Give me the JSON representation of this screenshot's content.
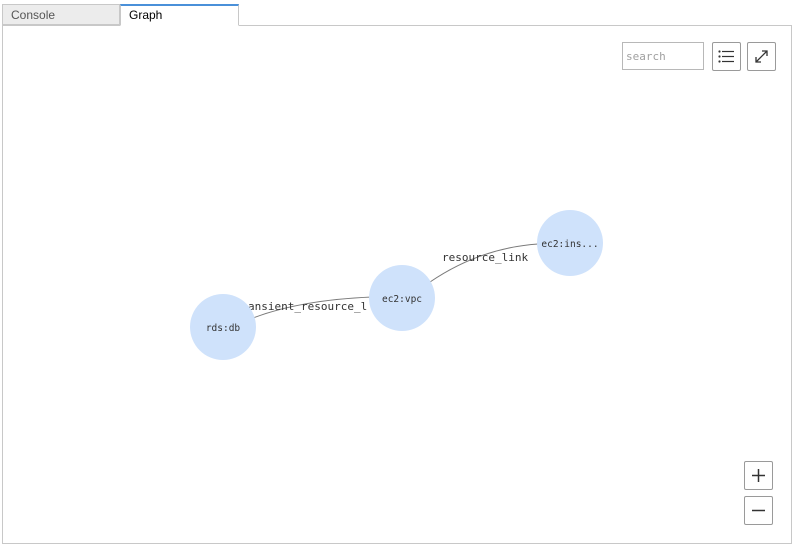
{
  "tabs": [
    {
      "label": "Console",
      "active": false
    },
    {
      "label": "Graph",
      "active": true
    }
  ],
  "toolbar": {
    "search_placeholder": "search",
    "list_icon": "list-icon",
    "expand_icon": "expand-icon"
  },
  "zoom": {
    "in_icon": "plus-icon",
    "out_icon": "minus-icon"
  },
  "graph": {
    "nodes": [
      {
        "id": "rds",
        "label": "rds:db"
      },
      {
        "id": "vpc",
        "label": "ec2:vpc"
      },
      {
        "id": "ins",
        "label": "ec2:ins..."
      }
    ],
    "edges": [
      {
        "from": "rds",
        "to": "vpc",
        "label": "ansient_resource_l"
      },
      {
        "from": "vpc",
        "to": "ins",
        "label": "resource_link"
      }
    ],
    "colors": {
      "node_fill": "#cfe2fb",
      "edge_stroke": "#7a7a7a",
      "text": "#333333"
    }
  }
}
